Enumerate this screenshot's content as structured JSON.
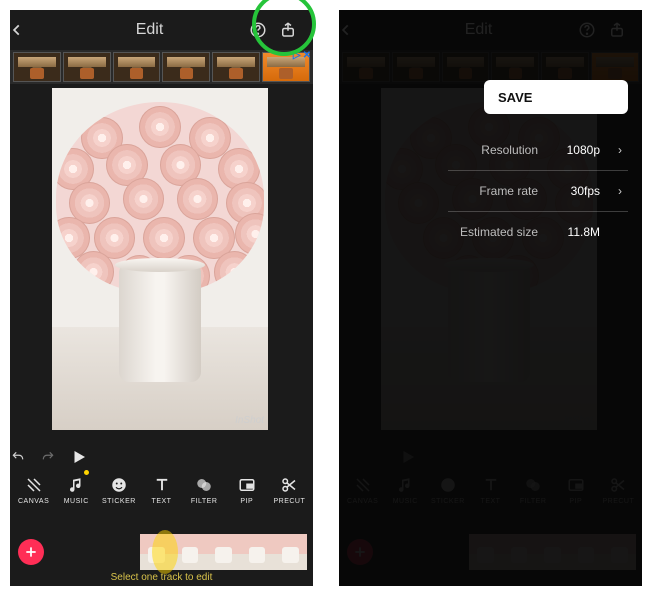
{
  "header": {
    "title": "Edit"
  },
  "preview": {
    "watermark": "InShot"
  },
  "tools": [
    {
      "key": "canvas",
      "label": "CANVAS"
    },
    {
      "key": "music",
      "label": "MUSIC",
      "dot": true
    },
    {
      "key": "sticker",
      "label": "STICKER"
    },
    {
      "key": "text",
      "label": "TEXT"
    },
    {
      "key": "filter",
      "label": "FILTER"
    },
    {
      "key": "pip",
      "label": "PIP"
    },
    {
      "key": "precut",
      "label": "PRECUT"
    }
  ],
  "timeline": {
    "hint": "Select one track to edit"
  },
  "export_panel": {
    "save_label": "SAVE",
    "rows": [
      {
        "label": "Resolution",
        "value": "1080p",
        "chevron": true
      },
      {
        "label": "Frame rate",
        "value": "30fps",
        "chevron": true
      },
      {
        "label": "Estimated size",
        "value": "11.8M",
        "chevron": false
      }
    ]
  }
}
